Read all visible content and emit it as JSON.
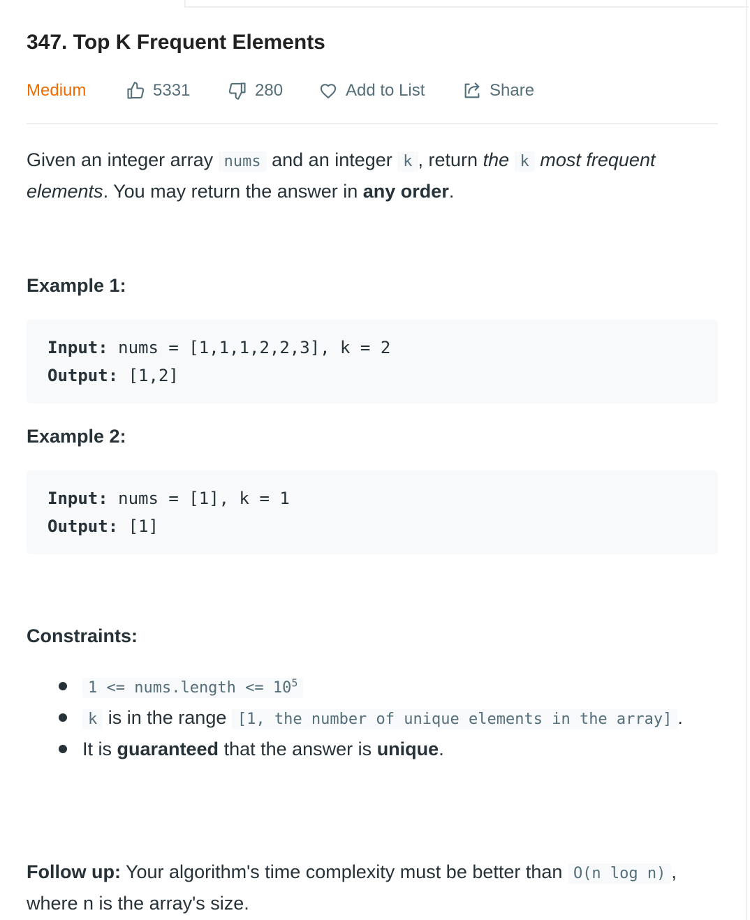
{
  "problem": {
    "title": "347. Top K Frequent Elements",
    "difficulty": "Medium",
    "likes": "5331",
    "dislikes": "280",
    "add_to_list": "Add to List",
    "share": "Share"
  },
  "description": {
    "t1": "Given an integer array ",
    "c1": "nums",
    "t2": " and an integer ",
    "c2": "k",
    "t3": ", return ",
    "i1": "the ",
    "c3": "k",
    "i2": " most frequent elements",
    "t4": ". You may return the answer in ",
    "b1": "any order",
    "t5": "."
  },
  "examples": [
    {
      "heading": "Example 1:",
      "input_label": "Input:",
      "input_value": " nums = [1,1,1,2,2,3], k = 2",
      "output_label": "Output:",
      "output_value": " [1,2]"
    },
    {
      "heading": "Example 2:",
      "input_label": "Input:",
      "input_value": " nums = [1], k = 1",
      "output_label": "Output:",
      "output_value": " [1]"
    }
  ],
  "constraints": {
    "heading": "Constraints:",
    "c1_code": "1 <= nums.length <= 10",
    "c1_sup": "5",
    "c2_code_k": "k",
    "c2_text": " is in the range ",
    "c2_code_range": "[1, the number of unique elements in the array]",
    "c2_end": ".",
    "c3_t1": "It is ",
    "c3_b1": "guaranteed",
    "c3_t2": " that the answer is ",
    "c3_b2": "unique",
    "c3_t3": "."
  },
  "follow_up": {
    "label": "Follow up:",
    "text": " Your algorithm's time complexity must be better than ",
    "code": "O(n log n)",
    "end": ", where n is the array's size."
  },
  "icons": [
    "thumbs-up-icon",
    "thumbs-down-icon",
    "heart-icon",
    "share-icon"
  ]
}
